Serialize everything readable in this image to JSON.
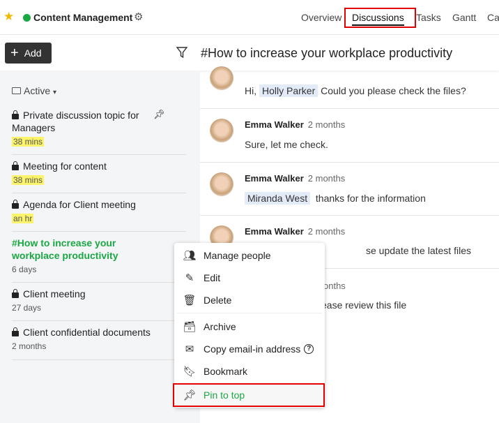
{
  "header": {
    "project": "Content Management",
    "status_color": "#1aa843",
    "tabs": [
      "Overview",
      "Discussions",
      "Tasks",
      "Gantt",
      "Ca"
    ],
    "active_tab": "Discussions"
  },
  "toolbar": {
    "add_label": "Add",
    "topic_title": "#How to increase your workplace productivity"
  },
  "sidebar": {
    "filter_label": "Active",
    "items": [
      {
        "title": "Private discussion topic for Managers",
        "meta": "38 mins",
        "locked": true,
        "pinned": true,
        "highlight": true
      },
      {
        "title": "Meeting for content",
        "meta": "38 mins",
        "locked": true,
        "highlight": true
      },
      {
        "title": "Agenda for Client meeting",
        "meta": "an hr",
        "locked": true,
        "highlight": true
      },
      {
        "title": "#How to increase your workplace productivity",
        "meta": "6 days",
        "active": true
      },
      {
        "title": "Client meeting",
        "meta": "27 days",
        "locked": true
      },
      {
        "title": "Client confidential documents",
        "meta": "2 months",
        "locked": true
      }
    ]
  },
  "messages": [
    {
      "prefix": "Hi,",
      "mention": "Holly Parker",
      "text": "Could you please check the files?"
    },
    {
      "author": "Emma Walker",
      "time": "2 months",
      "text": "Sure, let me check."
    },
    {
      "author": "Emma Walker",
      "time": "2 months",
      "mention": "Miranda West",
      "text": "thanks for the information"
    },
    {
      "author": "Emma Walker",
      "time": "2 months",
      "text": "se update the latest files"
    },
    {
      "time": "onths",
      "text": "ease review this file"
    }
  ],
  "context_menu": {
    "items": [
      "Manage people",
      "Edit",
      "Delete",
      "Archive",
      "Copy email-in address",
      "Bookmark",
      "Pin to top"
    ],
    "highlighted": "Pin to top",
    "accent": "#1aa843"
  }
}
